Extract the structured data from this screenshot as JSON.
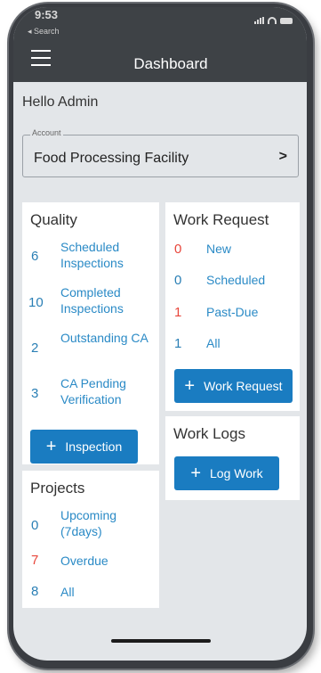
{
  "status": {
    "time": "9:53",
    "back_app": "◂ Search"
  },
  "header": {
    "title": "Dashboard"
  },
  "greeting": "Hello Admin",
  "account": {
    "legend": "Account",
    "value": "Food Processing Facility",
    "chevron": ">"
  },
  "quality": {
    "title": "Quality",
    "items": [
      {
        "count": "6",
        "label": "Scheduled Inspections"
      },
      {
        "count": "10",
        "label": "Completed Inspections"
      },
      {
        "count": "2",
        "label": "Outstanding CA"
      },
      {
        "count": "3",
        "label": "CA Pending Verification"
      }
    ],
    "button": "Inspection"
  },
  "projects": {
    "title": "Projects",
    "items": [
      {
        "count": "0",
        "label": "Upcoming (7days)"
      },
      {
        "count": "7",
        "label": "Overdue"
      },
      {
        "count": "8",
        "label": "All"
      }
    ]
  },
  "work_request": {
    "title": "Work Request",
    "items": [
      {
        "count": "0",
        "label": "New"
      },
      {
        "count": "0",
        "label": "Scheduled"
      },
      {
        "count": "1",
        "label": "Past-Due"
      },
      {
        "count": "1",
        "label": "All"
      }
    ],
    "button": "Work Request"
  },
  "work_logs": {
    "title": "Work Logs",
    "button": "Log Work"
  },
  "colors": {
    "accent": "#1a7cc1",
    "link": "#2a8ac6",
    "alert": "#e8463b",
    "header": "#3e4246"
  }
}
